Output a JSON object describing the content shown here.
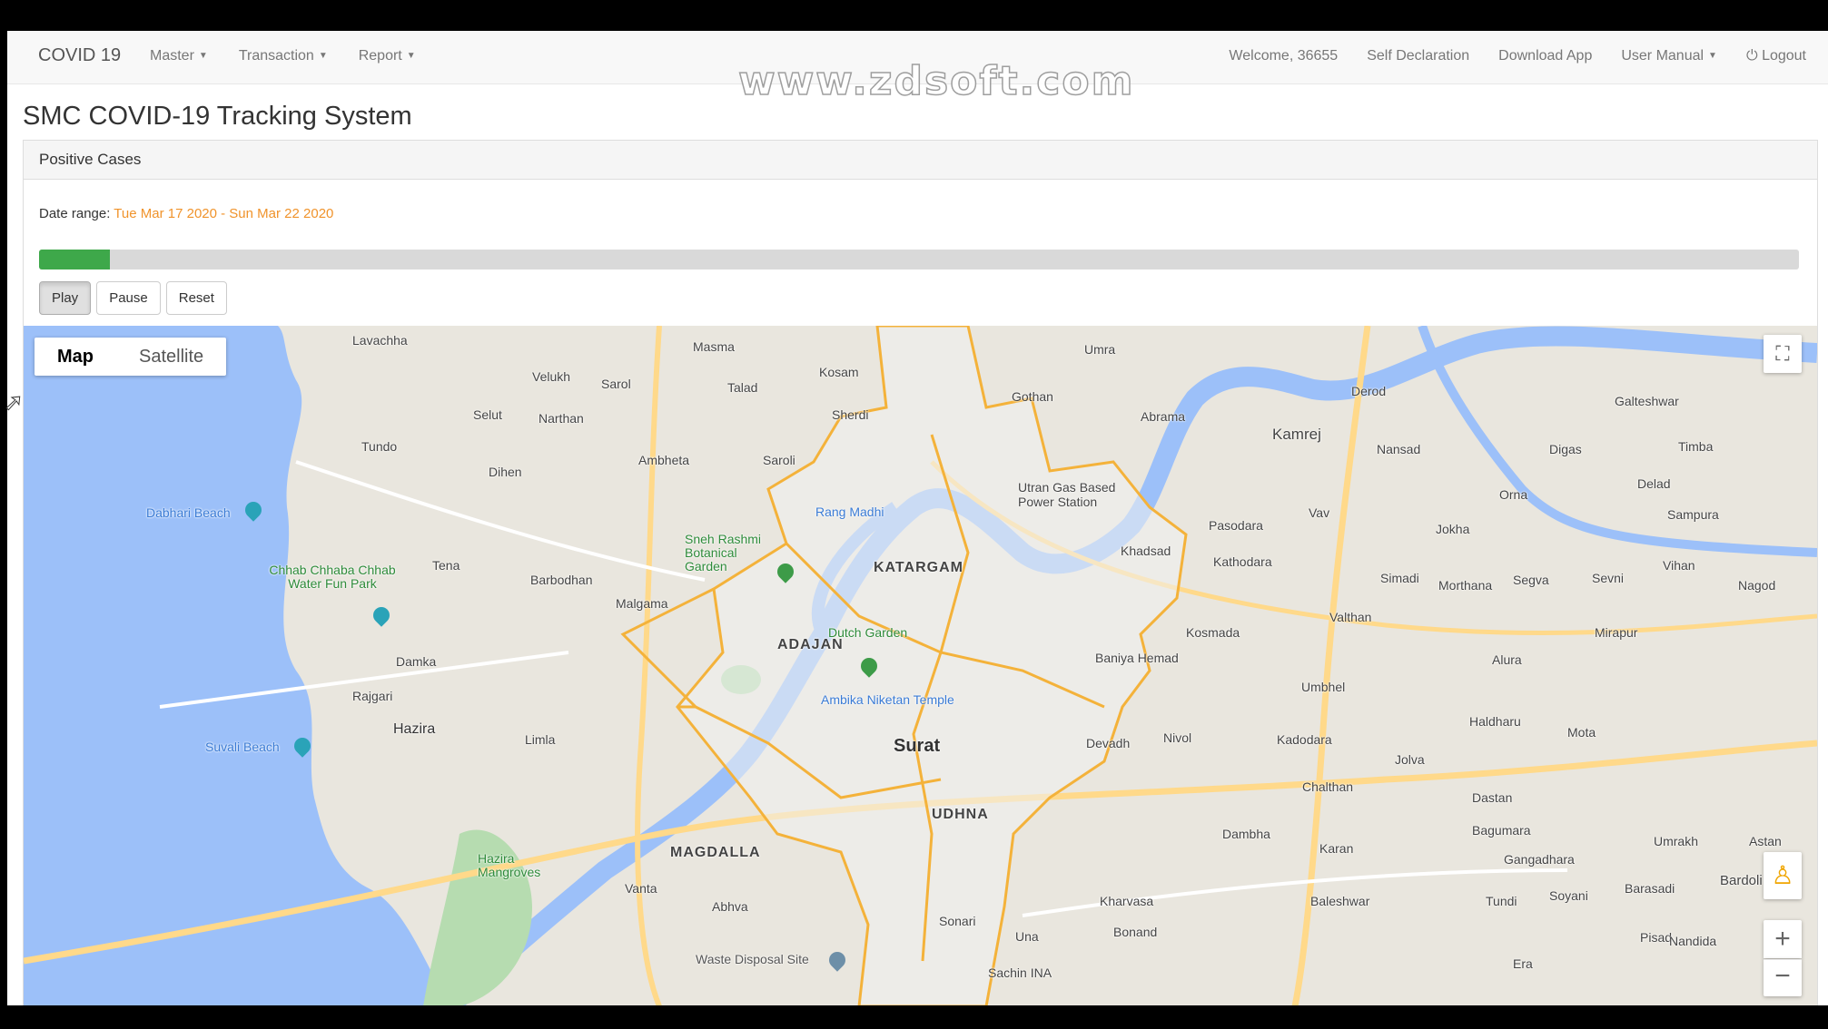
{
  "navbar": {
    "brand": "COVID 19",
    "menus": [
      "Master",
      "Transaction",
      "Report"
    ],
    "right_links": [
      "Welcome, 36655",
      "Self Declaration",
      "Download App",
      "User Manual"
    ],
    "logout": "Logout"
  },
  "watermark": "www.zdsoft.com",
  "page_title": "SMC COVID-19 Tracking System",
  "panel": {
    "heading": "Positive Cases",
    "date_label": "Date range:",
    "date_value": "Tue Mar 17 2020 - Sun Mar 22 2020",
    "progress_fraction": 0.04,
    "buttons": {
      "play": "Play",
      "pause": "Pause",
      "reset": "Reset"
    }
  },
  "map": {
    "type_map": "Map",
    "type_satellite": "Satellite",
    "city": "Surat",
    "areas": [
      "KATARGAM",
      "ADAJAN",
      "UDHNA",
      "MAGDALLA"
    ],
    "places": [
      "Lavachha",
      "Masma",
      "Kosam",
      "Umra",
      "Gothan",
      "Velukh",
      "Sarol",
      "Talad",
      "Selut",
      "Narthan",
      "Sherdi",
      "Abrama",
      "Kamrej",
      "Derod",
      "Galteshwar",
      "Nansad",
      "Digas",
      "Timba",
      "Tundo",
      "Dihen",
      "Ambheta",
      "Saroli",
      "Orna",
      "Delad",
      "Utran Gas Based Power Station",
      "Pasodara",
      "Vav",
      "Jokha",
      "Sampura",
      "Tena",
      "Barbodhan",
      "Kathodara",
      "Khadsad",
      "Simadi",
      "Morthana",
      "Segva",
      "Sevni",
      "Vihan",
      "Nagod",
      "Malgama",
      "Kosmada",
      "Valthan",
      "Damka",
      "Baniya Hemad",
      "Alura",
      "Mirapur",
      "Rajgari",
      "Umbhel",
      "Hazira",
      "Limla",
      "Haldharu",
      "Kadodara",
      "Devadh",
      "Nivol",
      "Jolva",
      "Mota",
      "Chalthan",
      "Dastan",
      "Bagumara",
      "Dambha",
      "Karan",
      "Gangadhara",
      "Vanta",
      "Abhva",
      "Kharvasa",
      "Baleshwar",
      "Tundi",
      "Soyani",
      "Barasadi",
      "Sonari",
      "Bonand",
      "Pisad",
      "Nandida",
      "Una",
      "Sachin INA",
      "Era",
      "Astan",
      "Umrakh",
      "Bardoli"
    ],
    "pois": [
      "Dabhari Beach",
      "Chhab Chhaba Chhab Water Fun Park",
      "Suvali Beach",
      "Sneh Rashmi Botanical Garden",
      "Rang Madhi",
      "Dutch Garden",
      "Ambika Niketan Temple",
      "Hazira Mangroves",
      "Waste Disposal Site"
    ]
  },
  "colors": {
    "accent_orange": "#f0932b",
    "progress_green": "#3ea84a",
    "water": "#9cc0f9",
    "boundary": "#f4b23a"
  },
  "icons": {
    "logout": "power-icon",
    "fullscreen": "fullscreen-icon",
    "pegman": "pegman-icon",
    "zoom_in": "plus-icon",
    "zoom_out": "minus-icon"
  }
}
